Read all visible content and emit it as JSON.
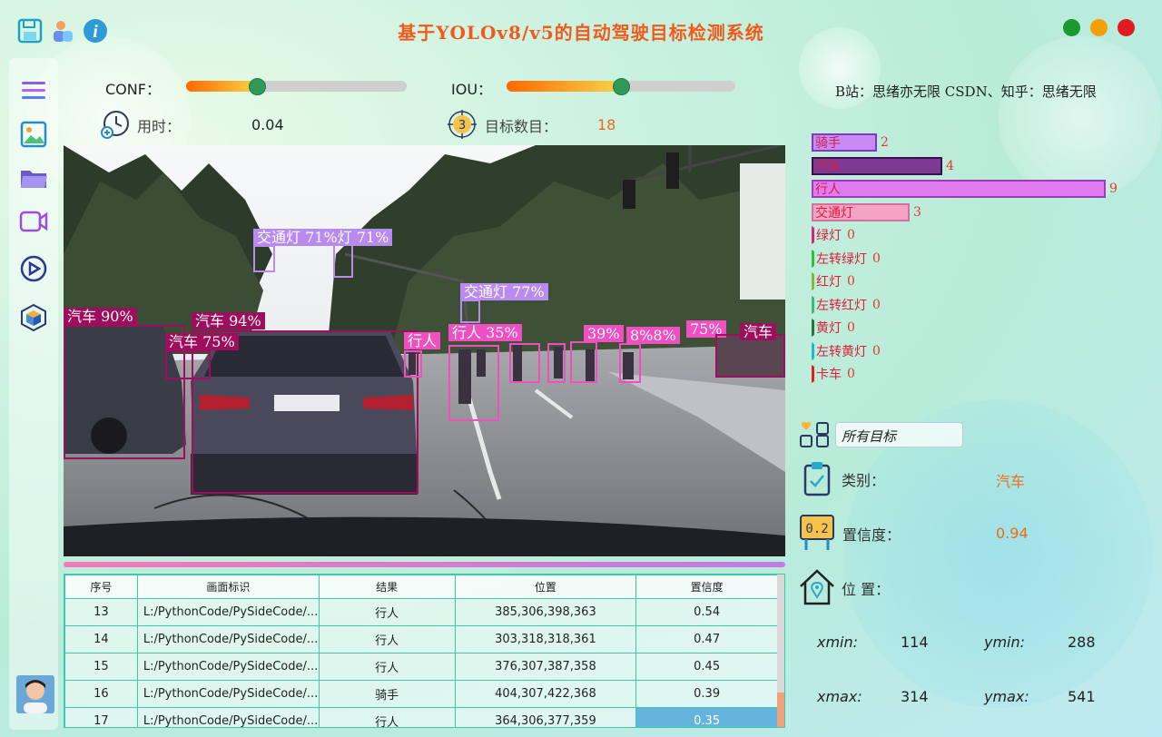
{
  "app": {
    "title": "基于YOLOv8/v5的自动驾驶目标检测系统",
    "credit": "B站：思绪亦无限  CSDN、知乎：思绪无限"
  },
  "window_controls": [
    {
      "name": "minimize-button",
      "color": "#1a9a2c"
    },
    {
      "name": "maximize-button",
      "color": "#f5a000"
    },
    {
      "name": "close-button",
      "color": "#e01c1c"
    }
  ],
  "controls": {
    "conf_label": "CONF：",
    "conf_value": 0.32,
    "iou_label": "IOU：",
    "iou_value": 0.5,
    "time_label": "用时：",
    "time_value": "0.04",
    "count_label": "目标数目：",
    "count_value": "18"
  },
  "detections": [
    {
      "label": "汽车 90%",
      "color": "#9c0f5d"
    },
    {
      "label": "汽车 94%",
      "color": "#9c0f5d"
    },
    {
      "label": "汽车 75%",
      "color": "#9c0f5d"
    },
    {
      "label": "交通灯 71%灯 71%",
      "color": "#b98af0"
    },
    {
      "label": "交通灯 77%",
      "color": "#b98af0"
    },
    {
      "label": "行人",
      "color": "#f04fc2"
    },
    {
      "label": "行人 35%",
      "color": "#f04fc2"
    },
    {
      "label": "39%",
      "color": "#f04fc2"
    },
    {
      "label": "8%8%",
      "color": "#f04fc2"
    },
    {
      "label": "75%",
      "color": "#f04fc2"
    },
    {
      "label": "汽车",
      "color": "#9c0f5d"
    }
  ],
  "class_counts": [
    {
      "name": "骑手",
      "count": 2,
      "fill": "#c98af5",
      "border": "#7a3bc0",
      "text": "#d81b4a"
    },
    {
      "name": "汽车",
      "count": 4,
      "fill": "#7c3a94",
      "border": "#3a1050",
      "text": "#e01b3b"
    },
    {
      "name": "行人",
      "count": 9,
      "fill": "#e07cf0",
      "border": "#9d3bbd",
      "text": "#e01b3b"
    },
    {
      "name": "交通灯",
      "count": 3,
      "fill": "#f4a3c5",
      "border": "#d66f9a",
      "text": "#e01b3b"
    },
    {
      "name": "绿灯",
      "count": 0,
      "fill": "#e0207a",
      "border": "#e0207a",
      "text": "#e01b3b"
    },
    {
      "name": "左转绿灯",
      "count": 0,
      "fill": "#2bbf3a",
      "border": "#2bbf3a",
      "text": "#e01b3b"
    },
    {
      "name": "红灯",
      "count": 0,
      "fill": "#87b53a",
      "border": "#87b53a",
      "text": "#e01b3b"
    },
    {
      "name": "左转红灯",
      "count": 0,
      "fill": "#3ab87a",
      "border": "#3ab87a",
      "text": "#e01b3b"
    },
    {
      "name": "黄灯",
      "count": 0,
      "fill": "#1f7a3a",
      "border": "#1f7a3a",
      "text": "#e01b3b"
    },
    {
      "name": "左转黄灯",
      "count": 0,
      "fill": "#22b8c6",
      "border": "#22b8c6",
      "text": "#e01b3b"
    },
    {
      "name": "卡车",
      "count": 0,
      "fill": "#e02020",
      "border": "#e02020",
      "text": "#e01b3b"
    }
  ],
  "filter": {
    "selected": "所有目标"
  },
  "details": {
    "class_label": "类别：",
    "class_value": "汽车",
    "conf_label": "置信度：",
    "conf_value": "0.94",
    "pos_label": "位 置：",
    "xmin_label": "xmin:",
    "xmin": "114",
    "ymin_label": "ymin:",
    "ymin": "288",
    "xmax_label": "xmax:",
    "xmax": "314",
    "ymax_label": "ymax:",
    "ymax": "541"
  },
  "table": {
    "headers": [
      "序号",
      "画面标识",
      "结果",
      "位置",
      "置信度"
    ],
    "rows": [
      [
        "13",
        "L:/PythonCode/PySideCode/...",
        "行人",
        "385,306,398,363",
        "0.54"
      ],
      [
        "14",
        "L:/PythonCode/PySideCode/...",
        "行人",
        "303,318,318,361",
        "0.47"
      ],
      [
        "15",
        "L:/PythonCode/PySideCode/...",
        "行人",
        "376,307,387,358",
        "0.45"
      ],
      [
        "16",
        "L:/PythonCode/PySideCode/...",
        "骑手",
        "404,307,422,368",
        "0.39"
      ],
      [
        "17",
        "L:/PythonCode/PySideCode/...",
        "行人",
        "364,306,377,359",
        "0.35"
      ]
    ]
  }
}
